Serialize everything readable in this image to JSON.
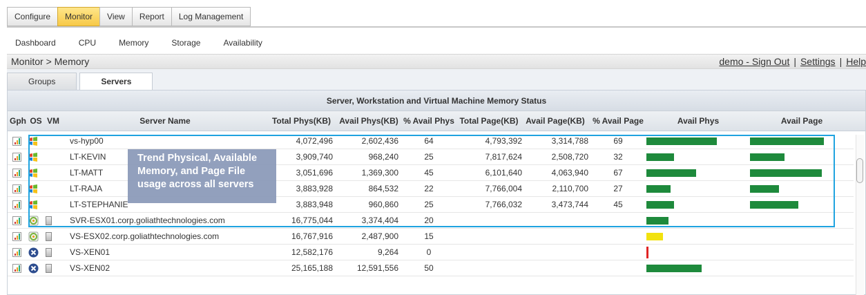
{
  "top_tabs": [
    {
      "label": "Configure",
      "active": false
    },
    {
      "label": "Monitor",
      "active": true
    },
    {
      "label": "View",
      "active": false
    },
    {
      "label": "Report",
      "active": false
    },
    {
      "label": "Log Management",
      "active": false
    }
  ],
  "sub_nav": [
    "Dashboard",
    "CPU",
    "Memory",
    "Storage",
    "Availability"
  ],
  "breadcrumb": "Monitor > Memory",
  "user_links": {
    "signout": "demo - Sign Out",
    "settings": "Settings",
    "help": "Help",
    "separator": "|"
  },
  "section_tabs": [
    {
      "label": "Groups",
      "active": false
    },
    {
      "label": "Servers",
      "active": true
    }
  ],
  "grid": {
    "title": "Server, Workstation and Virtual Machine Memory Status",
    "columns": [
      "Gph",
      "OS",
      "VM",
      "Server Name",
      "Total Phys(KB)",
      "Avail Phys(KB)",
      "% Avail Phys",
      "Total Page(KB)",
      "Avail Page(KB)",
      "% Avail Page",
      "Avail Phys",
      "Avail Page"
    ],
    "rows": [
      {
        "os": "windows",
        "vm": false,
        "name": "vs-hyp00",
        "total_phys": "4,072,496",
        "avail_phys": "2,602,436",
        "pct_phys": "64",
        "total_page": "4,793,392",
        "avail_page": "3,314,788",
        "pct_page": "69",
        "phys_level": 64,
        "page_level": 69,
        "phys_color": "#1e8a3c"
      },
      {
        "os": "windows",
        "vm": false,
        "name": "LT-KEVIN",
        "total_phys": "3,909,740",
        "avail_phys": "968,240",
        "pct_phys": "25",
        "total_page": "7,817,624",
        "avail_page": "2,508,720",
        "pct_page": "32",
        "phys_level": 25,
        "page_level": 32,
        "phys_color": "#1e8a3c"
      },
      {
        "os": "windows",
        "vm": false,
        "name": "LT-MATT",
        "total_phys": "3,051,696",
        "avail_phys": "1,369,300",
        "pct_phys": "45",
        "total_page": "6,101,640",
        "avail_page": "4,063,940",
        "pct_page": "67",
        "phys_level": 45,
        "page_level": 67,
        "phys_color": "#1e8a3c"
      },
      {
        "os": "windows",
        "vm": false,
        "name": "LT-RAJA",
        "total_phys": "3,883,928",
        "avail_phys": "864,532",
        "pct_phys": "22",
        "total_page": "7,766,004",
        "avail_page": "2,110,700",
        "pct_page": "27",
        "phys_level": 22,
        "page_level": 27,
        "phys_color": "#1e8a3c"
      },
      {
        "os": "windows",
        "vm": false,
        "name": "LT-STEPHANIE",
        "total_phys": "3,883,948",
        "avail_phys": "960,860",
        "pct_phys": "25",
        "total_page": "7,766,032",
        "avail_page": "3,473,744",
        "pct_page": "45",
        "phys_level": 25,
        "page_level": 45,
        "phys_color": "#1e8a3c"
      },
      {
        "os": "vmware",
        "vm": true,
        "name": "SVR-ESX01.corp.goliathtechnologies.com",
        "total_phys": "16,775,044",
        "avail_phys": "3,374,404",
        "pct_phys": "20",
        "total_page": "",
        "avail_page": "",
        "pct_page": "",
        "phys_level": 20,
        "page_level": 0,
        "phys_color": "#1e8a3c"
      },
      {
        "os": "vmware",
        "vm": true,
        "name": "VS-ESX02.corp.goliathtechnologies.com",
        "total_phys": "16,767,916",
        "avail_phys": "2,487,900",
        "pct_phys": "15",
        "total_page": "",
        "avail_page": "",
        "pct_page": "",
        "phys_level": 15,
        "page_level": 0,
        "phys_color": "#f2e20f"
      },
      {
        "os": "xen",
        "vm": true,
        "name": "VS-XEN01",
        "total_phys": "12,582,176",
        "avail_phys": "9,264",
        "pct_phys": "0",
        "total_page": "",
        "avail_page": "",
        "pct_page": "",
        "phys_level": 1,
        "page_level": 0,
        "phys_color": "#e02424"
      },
      {
        "os": "xen",
        "vm": true,
        "name": "VS-XEN02",
        "total_phys": "25,165,188",
        "avail_phys": "12,591,556",
        "pct_phys": "50",
        "total_page": "",
        "avail_page": "",
        "pct_page": "",
        "phys_level": 50,
        "page_level": 0,
        "phys_color": "#1e8a3c"
      }
    ]
  },
  "callout": {
    "text": "Trend Physical, Available Memory, and Page File usage across all servers"
  },
  "colors": {
    "accent": "#f7c948",
    "bar_green": "#1e8a3c",
    "bar_yellow": "#f2e20f",
    "bar_red": "#e02424",
    "highlight": "#1fa3e0"
  }
}
